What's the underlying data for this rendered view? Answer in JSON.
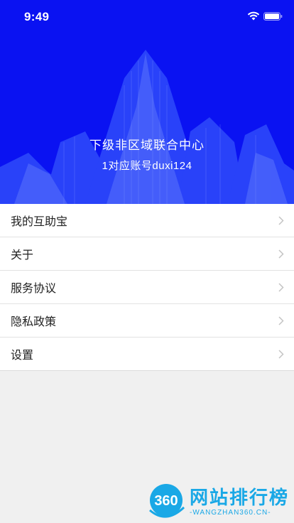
{
  "status_bar": {
    "time": "9:49"
  },
  "profile": {
    "organization": "下级非区域联合中心",
    "account_line": "1对应账号duxi124"
  },
  "menu": {
    "items": [
      {
        "label": "我的互助宝"
      },
      {
        "label": "关于"
      },
      {
        "label": "服务协议"
      },
      {
        "label": "隐私政策"
      },
      {
        "label": "设置"
      }
    ]
  },
  "watermark": {
    "logo_text": "360",
    "title": "网站排行榜",
    "subtitle": "-WANGZHAN360.CN-"
  },
  "colors": {
    "header_bg": "#0a12f2",
    "page_bg": "#f0f0f0",
    "watermark": "#1aa8e6"
  }
}
